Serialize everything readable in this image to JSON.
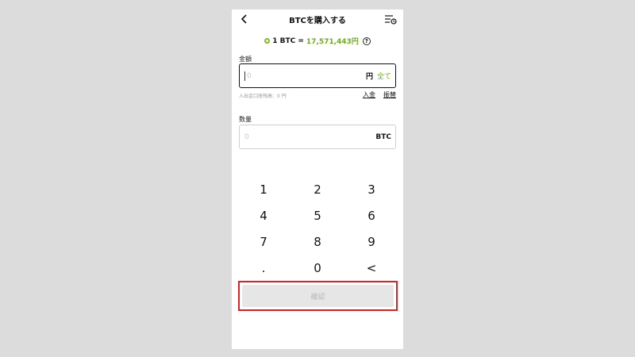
{
  "header": {
    "title": "BTCを購入する",
    "back_icon": "chevron-left",
    "history_icon": "list-clock"
  },
  "rate": {
    "lhs": "1 BTC =",
    "price": "17,571,443円",
    "help": "?"
  },
  "amount": {
    "label": "金額",
    "placeholder": "0",
    "unit": "円",
    "all_label": "全て",
    "balance_text": "入出金口座残高：0 円",
    "deposit_link": "入金",
    "transfer_link": "振替"
  },
  "quantity": {
    "label": "数量",
    "placeholder": "0",
    "unit": "BTC"
  },
  "keypad": {
    "keys": [
      "1",
      "2",
      "3",
      "4",
      "5",
      "6",
      "7",
      "8",
      "9",
      ".",
      "0",
      "<"
    ]
  },
  "confirm": {
    "label": "確認"
  },
  "colors": {
    "accent_green": "#6db014",
    "highlight_red": "#e02020",
    "disabled_bg": "#e6e6e6"
  }
}
